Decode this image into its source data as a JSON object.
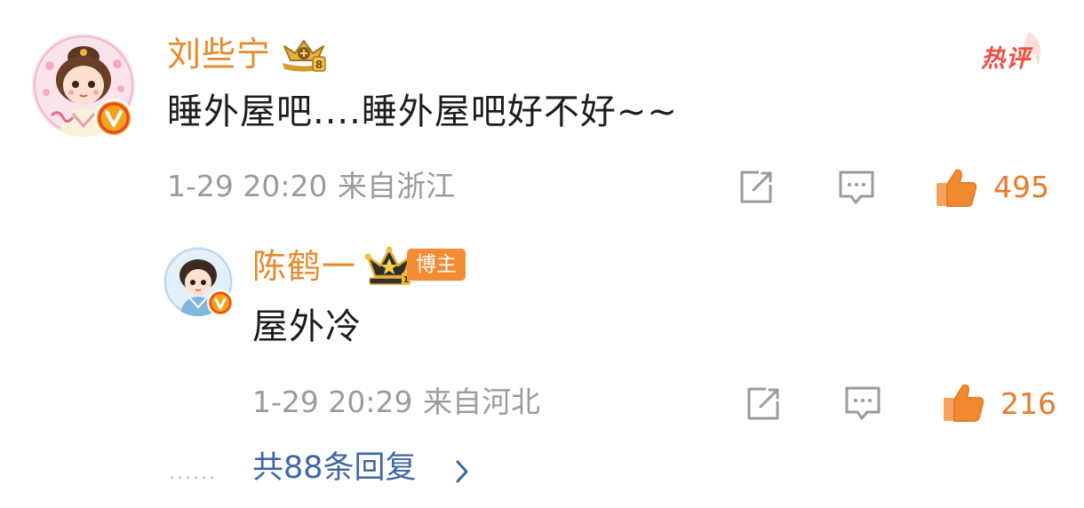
{
  "comment": {
    "username": "刘些宁",
    "text": "睡外屋吧....睡外屋吧好不好~~",
    "hot_tag": "热评",
    "date": "1-29 20:20",
    "location": "来自浙江",
    "likes": "495",
    "level_icon": "gold-level-badge-icon",
    "verified_icon": "verified-v-icon"
  },
  "reply": {
    "username": "陈鹤一",
    "badge": "博主",
    "text": "屋外冷",
    "date": "1-29 20:29",
    "location": "来自河北",
    "likes": "216",
    "level_icon": "crown-level-badge-icon",
    "verified_icon": "verified-v-icon"
  },
  "more_replies": {
    "dots": "......",
    "label": "共88条回复",
    "arrow": "chevron-right-icon"
  },
  "colors": {
    "username": "#e8892b",
    "like": "#e87b2a",
    "hot": "#f04e40",
    "link": "#3f66a6",
    "meta": "#9b9b9b",
    "badge": "#f58c34"
  }
}
